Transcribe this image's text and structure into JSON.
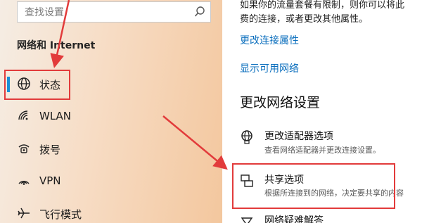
{
  "sidebar": {
    "search_placeholder": "查找设置",
    "section_title": "网络和 Internet",
    "items": [
      {
        "label": "状态",
        "icon": "globe-icon"
      },
      {
        "label": "WLAN",
        "icon": "wifi-icon"
      },
      {
        "label": "拨号",
        "icon": "dialup-icon"
      },
      {
        "label": "VPN",
        "icon": "vpn-icon"
      },
      {
        "label": "飞行模式",
        "icon": "airplane-icon"
      }
    ]
  },
  "main": {
    "intro_line1": "如果你的流量套餐有限制，则你可以将此",
    "intro_line2": "费的连接，或者更改其他属性。",
    "link_change_props": "更改连接属性",
    "link_show_networks": "显示可用网络",
    "section_heading": "更改网络设置",
    "options": [
      {
        "title": "更改适配器选项",
        "desc": "查看网络适配器并更改连接设置。",
        "icon": "adapter-icon"
      },
      {
        "title": "共享选项",
        "desc": "根据所连接到的网络，决定要共享的内容",
        "icon": "sharing-icon"
      },
      {
        "title": "网络疑难解答",
        "desc": "",
        "icon": "troubleshoot-icon"
      }
    ]
  },
  "colors": {
    "highlight": "#e23b3b",
    "accent": "#1a8fd6",
    "link": "#0a6ebd"
  }
}
